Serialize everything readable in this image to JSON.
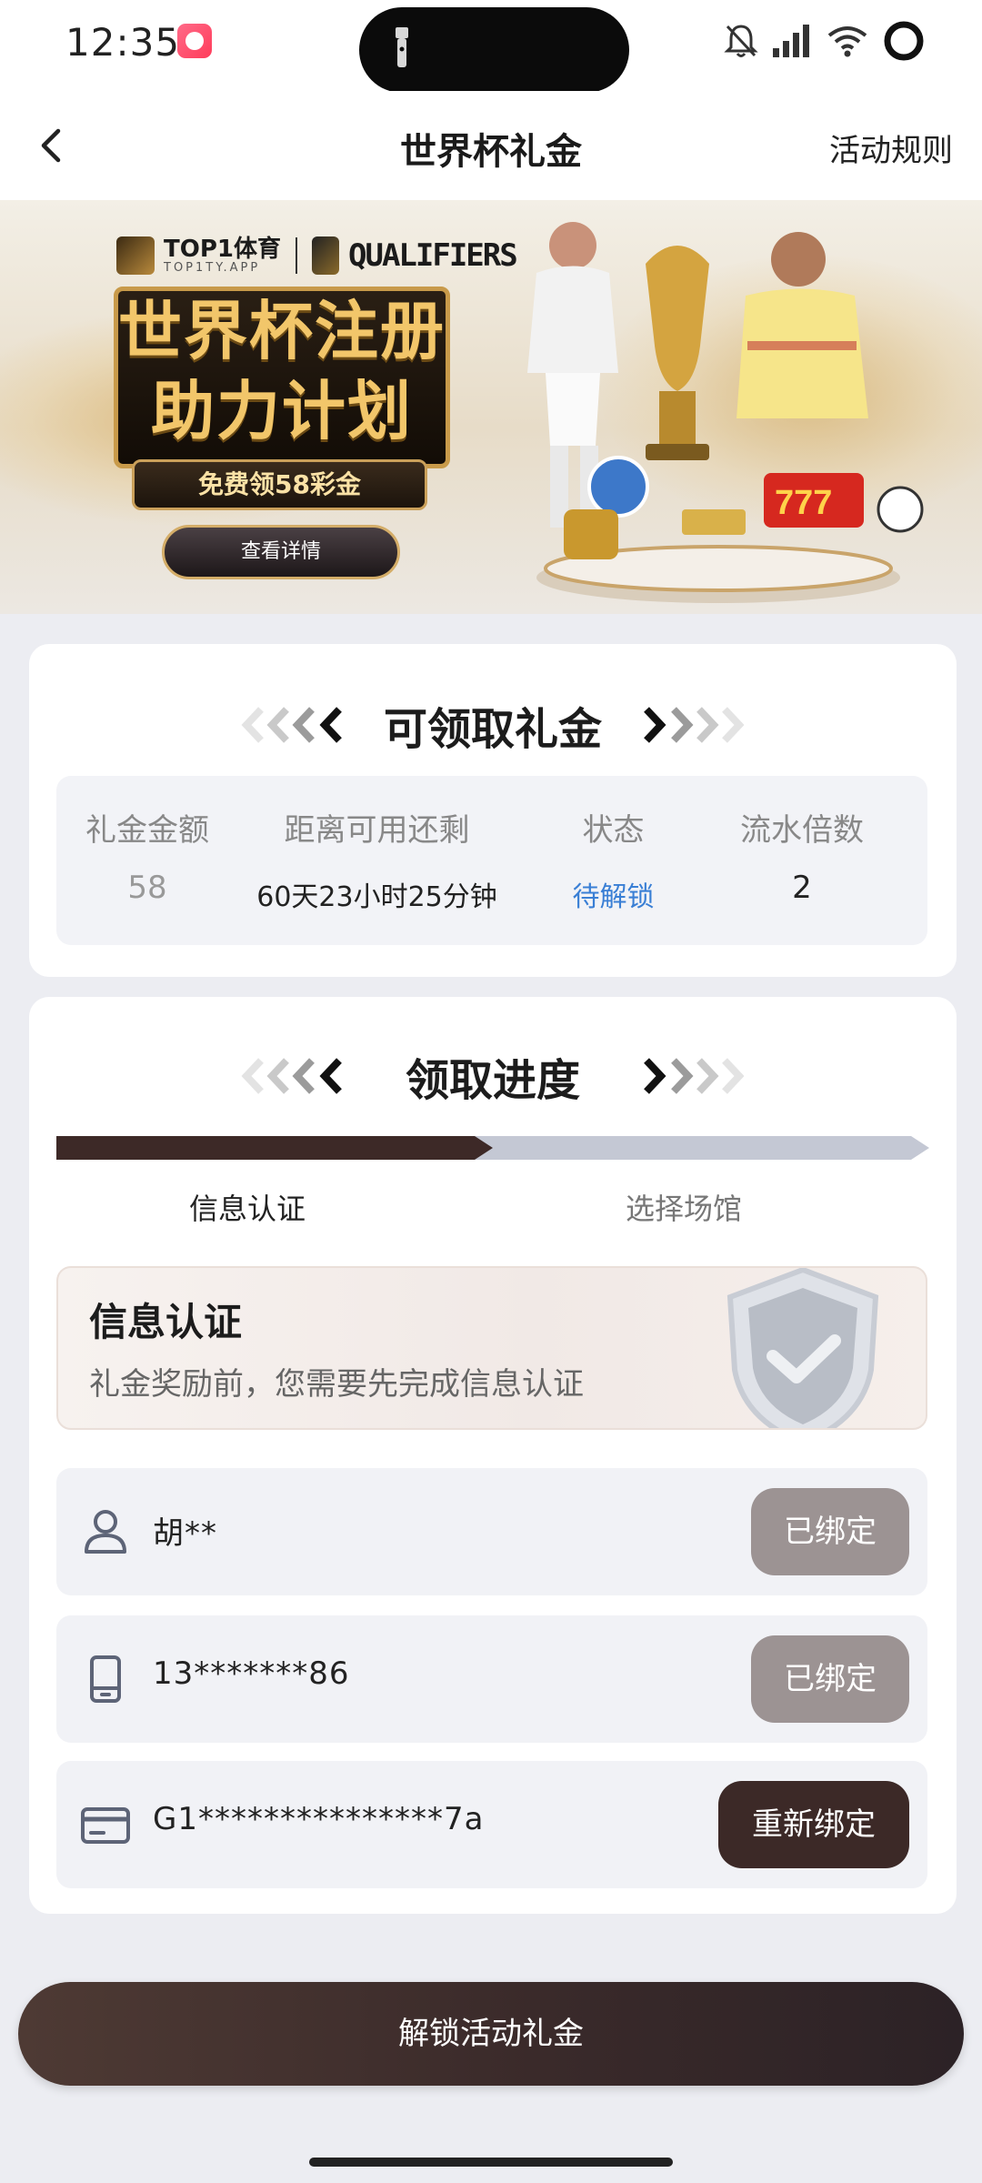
{
  "status_bar": {
    "time": "12:35"
  },
  "header": {
    "title": "世界杯礼金",
    "rules_link": "活动规则"
  },
  "banner": {
    "brand": "TOP1体育",
    "brand_sub": "TOP1TY.APP",
    "qualifiers": "QUALIFIERS",
    "headline_line1": "世界杯注册",
    "headline_line2": "助力计划",
    "free_text": "免费领58彩金",
    "detail_button": "查看详情"
  },
  "gift_card": {
    "title": "可领取礼金",
    "columns": [
      "礼金金额",
      "距离可用还剩",
      "状态",
      "流水倍数"
    ],
    "values": [
      "58",
      "60天23小时25分钟",
      "待解锁",
      "2"
    ]
  },
  "progress_card": {
    "title": "领取进度",
    "steps": [
      "信息认证",
      "选择场馆"
    ],
    "progress": 0.5,
    "verify_title": "信息认证",
    "verify_desc": "礼金奖励前，您需要先完成信息认证",
    "rows": [
      {
        "icon": "user-icon",
        "value": "胡**",
        "button": "已绑定"
      },
      {
        "icon": "phone-icon",
        "value": "13*******86",
        "button": "已绑定"
      },
      {
        "icon": "card-icon",
        "value": "G1***************7a",
        "button": "重新绑定"
      }
    ]
  },
  "unlock_button": "解锁活动礼金",
  "colors": {
    "accent_dark": "#3c2927",
    "status_blue": "#3a7fd5",
    "bound_gray": "#9c9393"
  }
}
